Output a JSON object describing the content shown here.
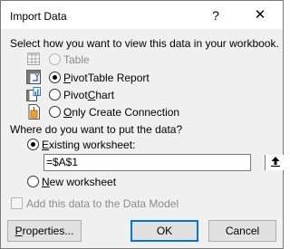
{
  "dialog": {
    "title": "Import Data",
    "help_label": "?",
    "close_label": "✕"
  },
  "view_section": {
    "prompt": "Select how you want to view this data in your workbook.",
    "options": [
      {
        "label": "Table",
        "selected": false,
        "enabled": false,
        "icon": "table-icon"
      },
      {
        "label": "PivotTable Report",
        "selected": true,
        "enabled": true,
        "icon": "pivottable-icon"
      },
      {
        "label": "PivotChart",
        "selected": false,
        "enabled": true,
        "icon": "pivotchart-icon"
      },
      {
        "label": "Only Create Connection",
        "selected": false,
        "enabled": true,
        "icon": "connection-icon"
      }
    ]
  },
  "location_section": {
    "prompt": "Where do you want to put the data?",
    "existing_label": "Existing worksheet:",
    "existing_selected": true,
    "cell_reference": "=$A$1",
    "collapse_icon": "range-selector-icon",
    "new_label": "New worksheet",
    "new_selected": false
  },
  "data_model": {
    "label": "Add this data to the Data Model",
    "checked": false,
    "enabled": false
  },
  "buttons": {
    "properties": "Properties...",
    "ok": "OK",
    "cancel": "Cancel"
  },
  "colors": {
    "default_button_border": "#0078d7",
    "dialog_bg": "#f0f0f0",
    "disabled_text": "#8c8c8c"
  }
}
